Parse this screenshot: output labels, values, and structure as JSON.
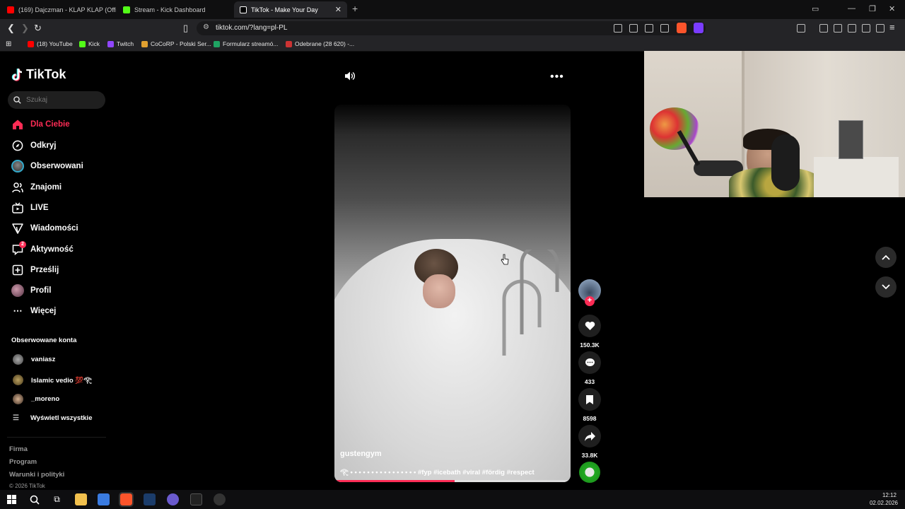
{
  "browser": {
    "tabs": [
      {
        "label": "(169) Dajczman - KLAP KLAP (Official",
        "icon": "youtube-icon",
        "color": "#ff0000"
      },
      {
        "label": "Stream - Kick Dashboard",
        "icon": "kick-icon",
        "color": "#53fc18"
      },
      {
        "label": "TikTok - Make Your Day",
        "icon": "tiktok-icon",
        "color": "#ffffff"
      }
    ],
    "new_tab": "+",
    "url": "tiktok.com/?lang=pl-PL",
    "bookmarks": [
      {
        "label": "(18) YouTube",
        "color": "#ff0000"
      },
      {
        "label": "Kick",
        "color": "#53fc18"
      },
      {
        "label": "Twitch",
        "color": "#9146ff"
      },
      {
        "label": "CoCoRP - Polski Ser...",
        "color": "#e0a030"
      },
      {
        "label": "Formularz streamó...",
        "color": "#1fa463"
      },
      {
        "label": "Odebrane (28 620) -...",
        "color": "#c33"
      }
    ]
  },
  "tiktok": {
    "logo": "TikTok",
    "search_placeholder": "Szukaj",
    "nav": [
      {
        "label": "Dla Ciebie",
        "icon": "home-icon",
        "active": true
      },
      {
        "label": "Odkryj",
        "icon": "compass-icon"
      },
      {
        "label": "Obserwowani",
        "icon": "following-avatar-icon"
      },
      {
        "label": "Znajomi",
        "icon": "friends-icon"
      },
      {
        "label": "LIVE",
        "icon": "live-tv-icon"
      },
      {
        "label": "Wiadomości",
        "icon": "send-icon"
      },
      {
        "label": "Aktywność",
        "icon": "activity-icon",
        "badge": "2"
      },
      {
        "label": "Prześlij",
        "icon": "upload-icon"
      },
      {
        "label": "Profil",
        "icon": "profile-avatar-icon"
      },
      {
        "label": "Więcej",
        "icon": "more-dots-icon"
      }
    ],
    "followed_title": "Obserwowane konta",
    "followed": [
      {
        "name": "vaniasz"
      },
      {
        "name": "Islamic vedio 💯𓂀"
      },
      {
        "name": "_moreno"
      }
    ],
    "show_all": "Wyświetl wszystkie",
    "footer": [
      "Firma",
      "Program",
      "Warunki i polityki"
    ],
    "copyright": "© 2026 TikTok",
    "video": {
      "author": "gustengym",
      "description": "𓂀 • • • • • • • • • • • • • • • • #fyp #icebath #viral #fördig #respect",
      "progress": 0.51,
      "likes": "150.3K",
      "comments": "433",
      "saves": "8598",
      "shares": "33.8K"
    }
  },
  "taskbar": {
    "time": "12:12",
    "date": "02.02.2026"
  },
  "colors": {
    "accent": "#fe2c55",
    "bg": "#000000"
  }
}
